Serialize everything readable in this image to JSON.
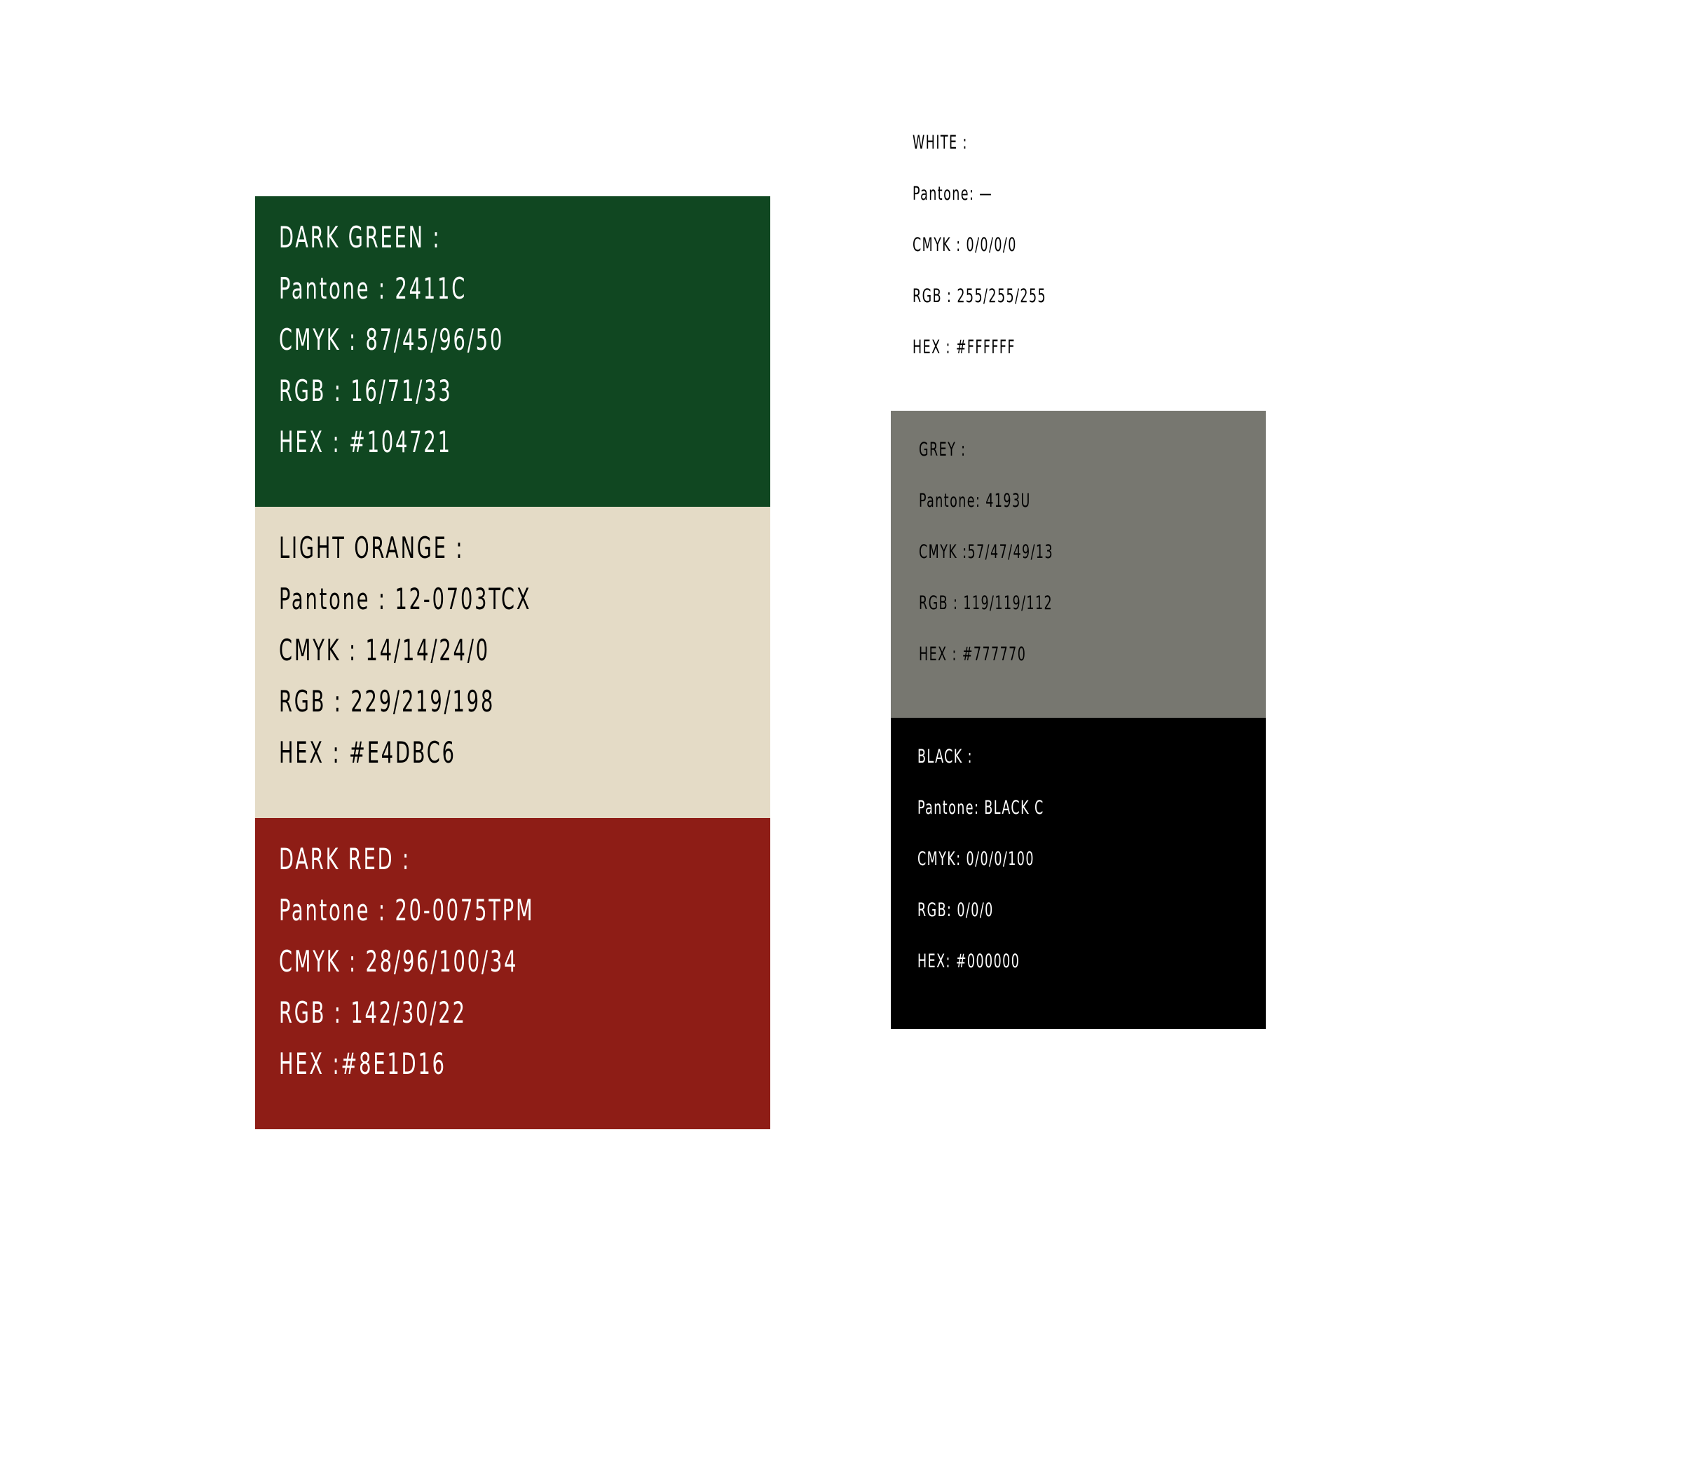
{
  "swatches": [
    {
      "id": "dark-green",
      "background": "#104721",
      "text_color": "#ffffff",
      "lines": [
        "DARK GREEN :",
        "Pantone : 2411C",
        "CMYK : 87/45/96/50",
        "RGB : 16/71/33",
        "HEX : #104721"
      ]
    },
    {
      "id": "light-orange",
      "background": "#E4DBC6",
      "text_color": "#000000",
      "lines": [
        "LIGHT ORANGE :",
        "Pantone : 12-0703TCX",
        "CMYK : 14/14/24/0",
        "RGB : 229/219/198",
        "HEX : #E4DBC6"
      ]
    },
    {
      "id": "dark-red",
      "background": "#8E1D16",
      "text_color": "#ffffff",
      "lines": [
        "DARK RED :",
        "Pantone : 20-0075TPM",
        "CMYK : 28/96/100/34",
        "RGB : 142/30/22",
        "HEX :#8E1D16"
      ]
    },
    {
      "id": "white",
      "background": "#FFFFFF",
      "text_color": "#000000",
      "lines": [
        "WHITE :",
        "Pantone: —",
        "CMYK : 0/0/0/0",
        "RGB : 255/255/255",
        "HEX : #FFFFFF"
      ]
    },
    {
      "id": "grey",
      "background": "#777770",
      "text_color": "#000000",
      "lines": [
        "GREY :",
        "Pantone: 4193U",
        "CMYK :57/47/49/13",
        "RGB : 119/119/112",
        "HEX : #777770"
      ]
    },
    {
      "id": "black",
      "background": "#000000",
      "text_color": "#ffffff",
      "lines": [
        "BLACK :",
        "Pantone: BLACK C",
        "CMYK: 0/0/0/100",
        "RGB: 0/0/0",
        "HEX: #000000"
      ]
    }
  ]
}
